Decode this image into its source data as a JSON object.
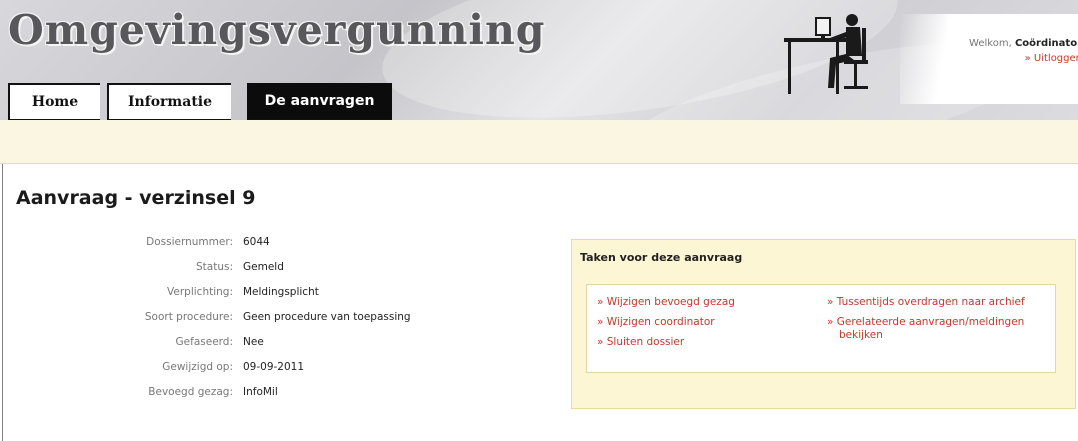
{
  "header": {
    "app_title": "Omgevingsvergunning",
    "welcome_text": "Welkom,",
    "user_name": "Coördinator",
    "logout_label": "» Uitloggen"
  },
  "tabs": [
    {
      "label": "Home",
      "active": false
    },
    {
      "label": "Informatie",
      "active": false
    },
    {
      "label": "De aanvragen",
      "active": true
    }
  ],
  "page": {
    "title": "Aanvraag - verzinsel 9"
  },
  "details": [
    {
      "label": "Dossiernummer:",
      "value": "6044"
    },
    {
      "label": "Status:",
      "value": "Gemeld"
    },
    {
      "label": "Verplichting:",
      "value": "Meldingsplicht"
    },
    {
      "label": "Soort procedure:",
      "value": "Geen procedure van toepassing"
    },
    {
      "label": "Gefaseerd:",
      "value": "Nee"
    },
    {
      "label": "Gewijzigd op:",
      "value": "09-09-2011"
    },
    {
      "label": "Bevoegd gezag:",
      "value": "InfoMil"
    }
  ],
  "tasks": {
    "header": "Taken voor deze aanvraag",
    "links": [
      "» Wijzigen bevoegd gezag",
      "» Wijzigen coordinator",
      "» Sluiten dossier",
      "» Tussentijds overdragen naar archief",
      "» Gerelateerde aanvragen/meldingen",
      "bekijken"
    ]
  },
  "colors": {
    "accent_link": "#c0392b",
    "tasks_background": "#fcf6d5",
    "strip_background": "#fbf6e2",
    "active_tab": "#0c0c0c"
  }
}
